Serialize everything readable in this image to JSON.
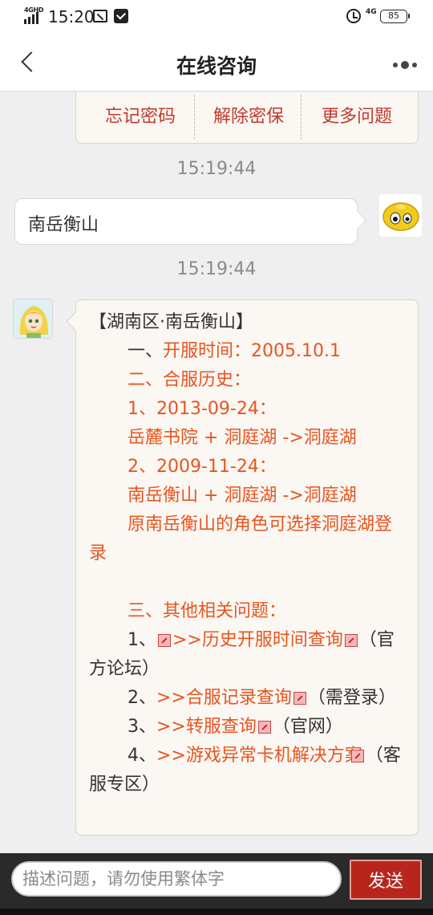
{
  "status_bar": {
    "network": "4GHD",
    "time": "15:20",
    "mobile_data": "4G",
    "battery": "85"
  },
  "nav": {
    "title": "在线咨询"
  },
  "quick_actions": [
    "忘记密码",
    "解除密保",
    "更多问题"
  ],
  "messages": [
    {
      "type": "timestamp",
      "text": "15:19:44"
    },
    {
      "type": "user",
      "text": "南岳衡山"
    },
    {
      "type": "timestamp",
      "text": "15:19:44"
    }
  ],
  "bot_reply": {
    "heading": "【湖南区·南岳衡山】",
    "l1_prefix": "一、",
    "l1_label": "开服时间：2005.10.1",
    "l2": "二、合服历史：",
    "l3": "1、2013-09-24：",
    "l4": "岳麓书院 + 洞庭湖 ->洞庭湖",
    "l5": "2、2009-11-24：",
    "l6": "南岳衡山 + 洞庭湖 ->洞庭湖",
    "l7": "原南岳衡山的角色可选择洞庭湖登录",
    "l8": "三、其他相关问题：",
    "q1_prefix": "1、",
    "q1_link": ">>历史开服时间查询",
    "q1_suffix": "（官方论坛）",
    "q2_prefix": "2、",
    "q2_link": ">>合服记录查询",
    "q2_suffix": "（需登录）",
    "q3_prefix": "3、",
    "q3_link": ">>转服查询",
    "q3_suffix": "（官网）",
    "q4_prefix": "4、",
    "q4_link": ">>游戏异常卡机解决方案",
    "q4_suffix": "（客服专区）"
  },
  "input": {
    "placeholder": "描述问题，请勿使用繁体字",
    "send_label": "发送"
  },
  "colors": {
    "accent": "#b8251d",
    "link": "#e8551f",
    "quick_text": "#c0392b",
    "bubble_bg": "#fbf7f3"
  }
}
